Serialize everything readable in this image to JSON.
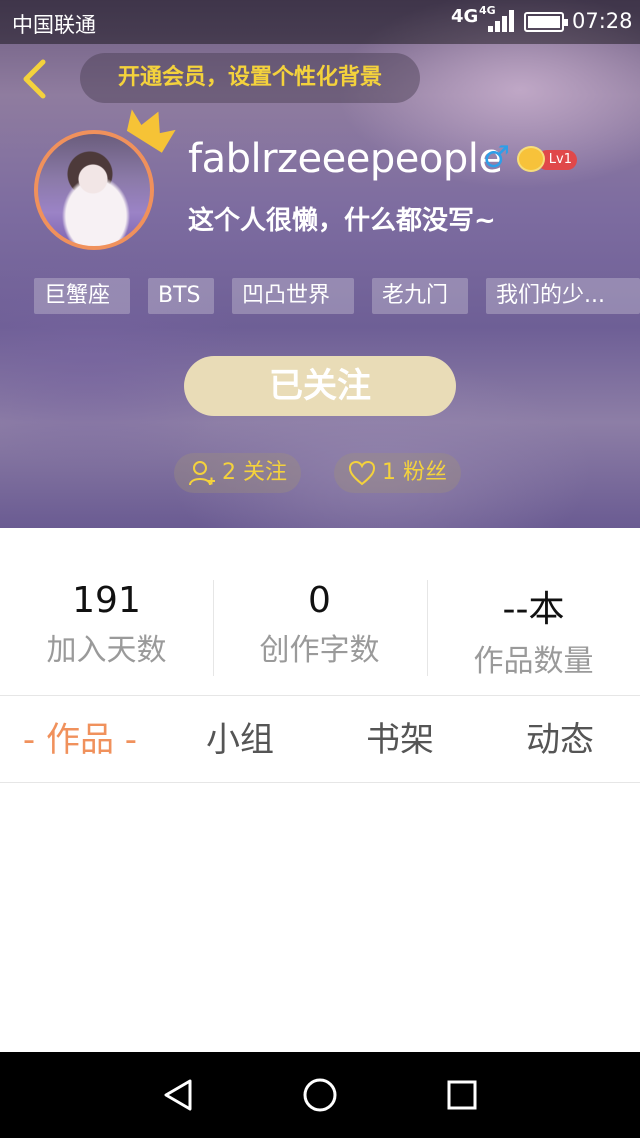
{
  "status_bar": {
    "carrier": "中国联通",
    "network": "4G",
    "network2": "4G",
    "time": "07:28"
  },
  "header": {
    "back_icon": "chevron-left-icon",
    "vip_banner": "开通会员，设置个性化背景"
  },
  "profile": {
    "username": "fablrzeeepeople",
    "gender_symbol": "♂",
    "level": "Lv1",
    "bio": "这个人很懒，什么都没写~",
    "tags": [
      "巨蟹座",
      "BTS",
      "凹凸世界",
      "老九门",
      "我们的少..."
    ],
    "follow_button": "已关注",
    "following": "2 关注",
    "fans": "1 粉丝"
  },
  "stats": [
    {
      "value": "191",
      "label": "加入天数"
    },
    {
      "value": "0",
      "label": "创作字数"
    },
    {
      "value": "--本",
      "label": "作品数量"
    }
  ],
  "tabs": [
    {
      "label": "- 作品 -",
      "active": true
    },
    {
      "label": "小组",
      "active": false
    },
    {
      "label": "书架",
      "active": false
    },
    {
      "label": "动态",
      "active": false
    }
  ],
  "colors": {
    "accent_orange": "#f0915c",
    "vip_yellow": "#f4d23c",
    "follow_button": "#e9dcb7",
    "gender_blue": "#2f9ee8",
    "level_red": "#e0484a"
  },
  "nav_bar": {
    "back": "triangle-back-icon",
    "home": "circle-home-icon",
    "recents": "square-recents-icon"
  }
}
